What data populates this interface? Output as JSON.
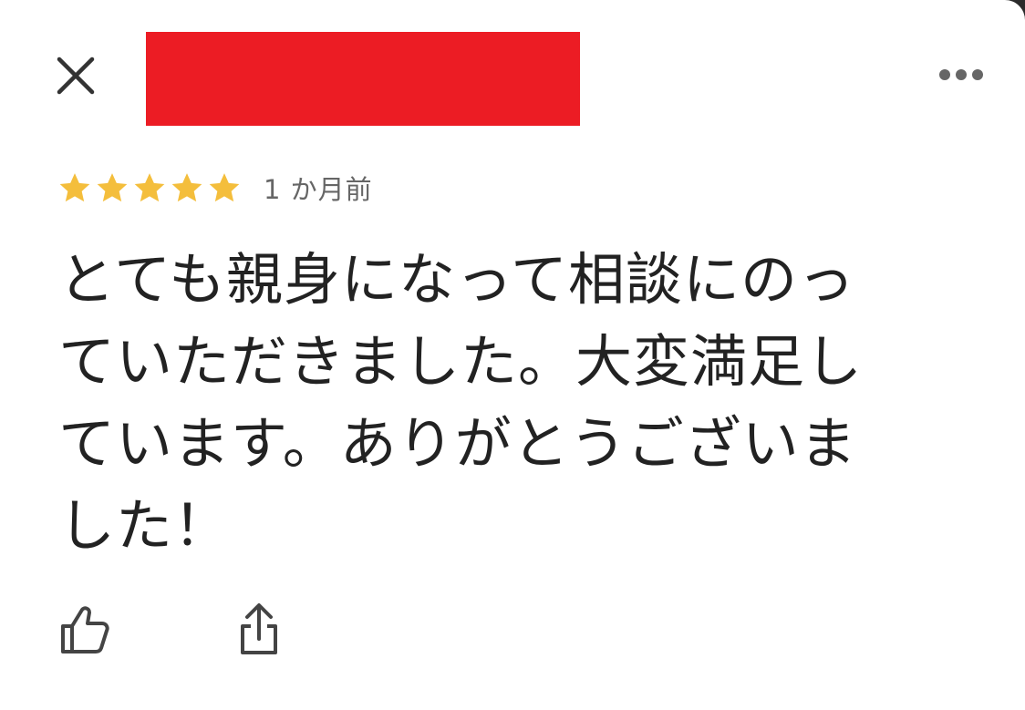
{
  "header": {
    "close_icon": "close-icon",
    "more_icon": "more-horizontal-icon",
    "reviewer_name_redacted": true
  },
  "review": {
    "rating": 5,
    "max_rating": 5,
    "star_color": "#f4be3c",
    "time_ago": "1 か月前",
    "text": "とても親身になって相談にのっ\nていただきました。大変満足し\nています。ありがとうございま\nした！"
  },
  "actions": {
    "like_icon": "thumbs-up-icon",
    "share_icon": "share-icon"
  },
  "colors": {
    "redaction": "#ec1c24",
    "icon": "#444444",
    "meta_text": "#666666"
  }
}
